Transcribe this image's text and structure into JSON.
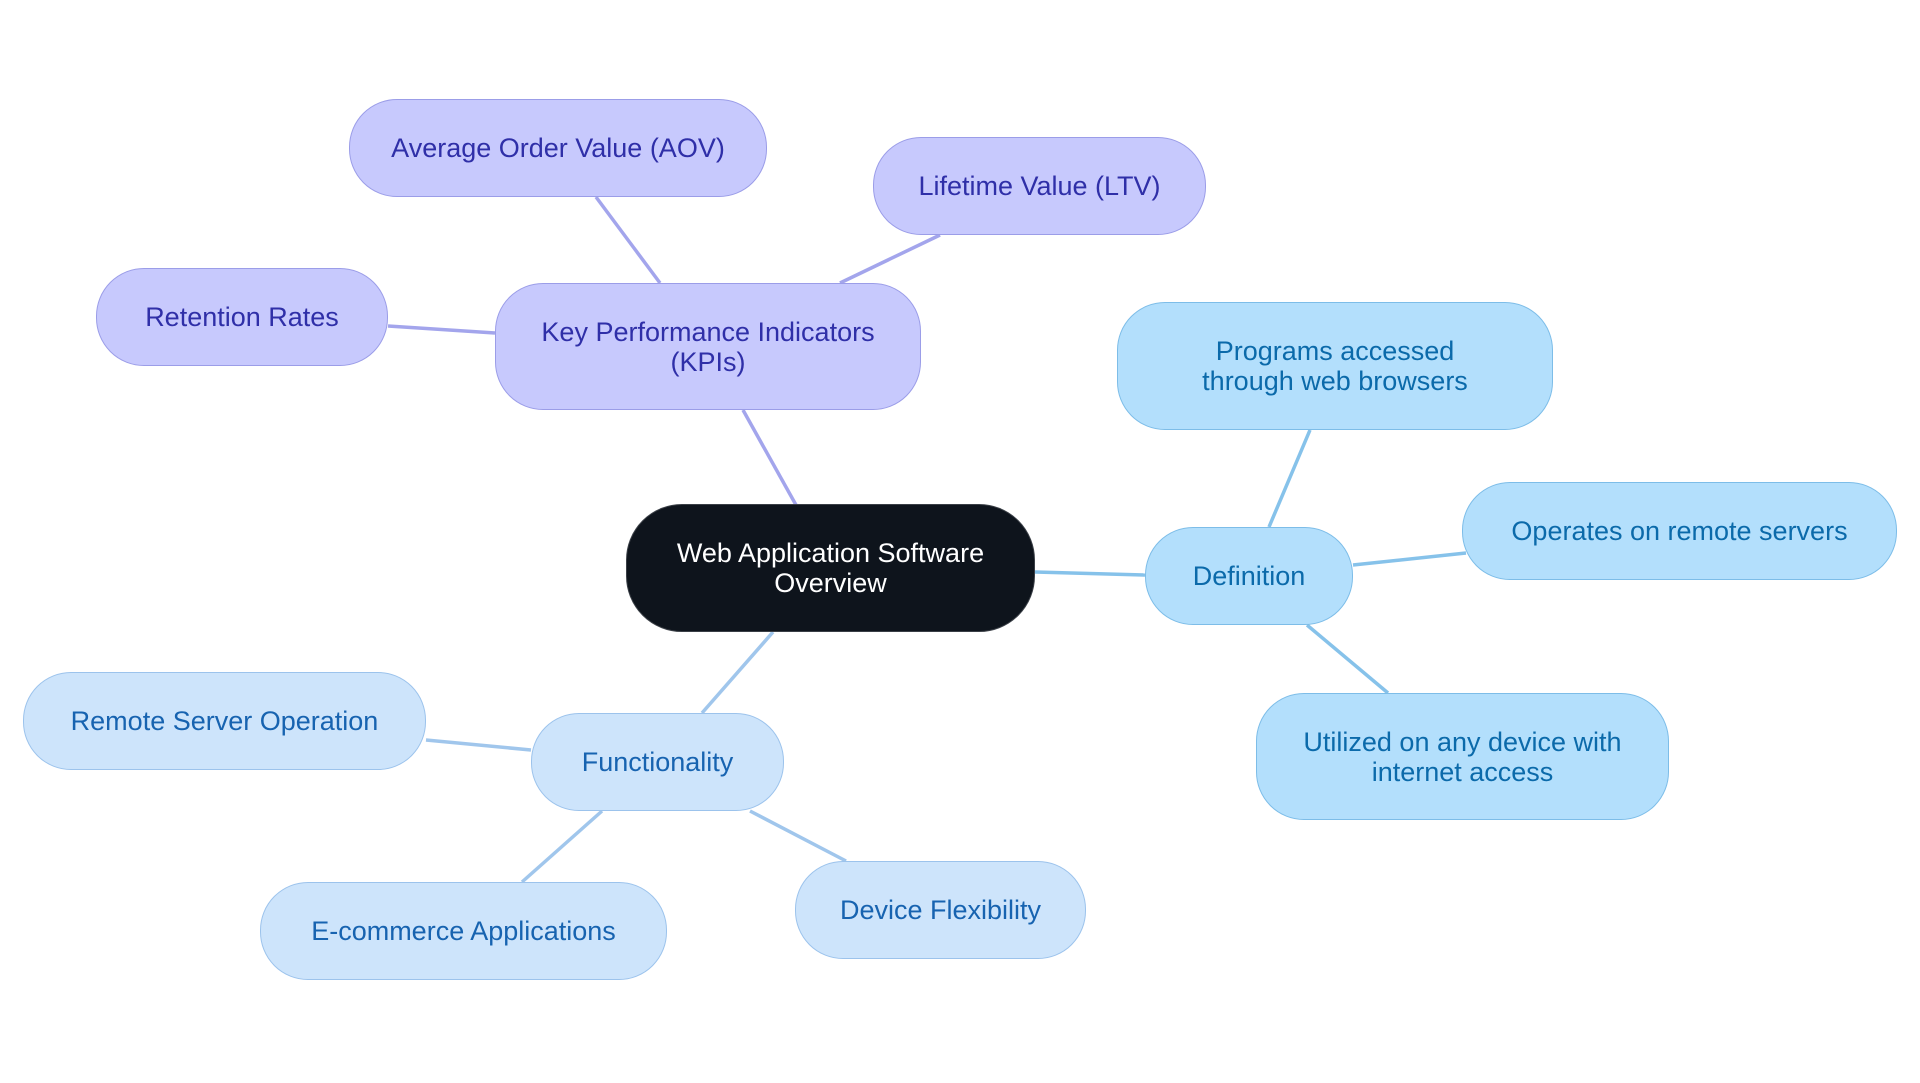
{
  "diagram": {
    "type": "mind-map",
    "colors": {
      "root_fill": "#0e141c",
      "root_text": "#ffffff",
      "kpi_fill": "#c7c9fd",
      "kpi_text": "#2f2fa8",
      "kpi_edge": "#a3a5ec",
      "definition_fill": "#b3dffc",
      "definition_text": "#0b6aaa",
      "definition_edge": "#86c2ea",
      "functionality_fill": "#cde4fb",
      "functionality_text": "#1763b0",
      "functionality_edge": "#a0c6ec"
    },
    "root": {
      "label": "Web Application Software Overview"
    },
    "branches": [
      {
        "id": "kpi",
        "label": "Key Performance Indicators (KPIs)",
        "children": [
          {
            "label": "Average Order Value (AOV)"
          },
          {
            "label": "Lifetime Value (LTV)"
          },
          {
            "label": "Retention Rates"
          }
        ]
      },
      {
        "id": "definition",
        "label": "Definition",
        "children": [
          {
            "label": "Programs accessed through web browsers"
          },
          {
            "label": "Operates on remote servers"
          },
          {
            "label": "Utilized on any device with internet access"
          }
        ]
      },
      {
        "id": "functionality",
        "label": "Functionality",
        "children": [
          {
            "label": "Remote Server Operation"
          },
          {
            "label": "E-commerce Applications"
          },
          {
            "label": "Device Flexibility"
          }
        ]
      }
    ]
  }
}
